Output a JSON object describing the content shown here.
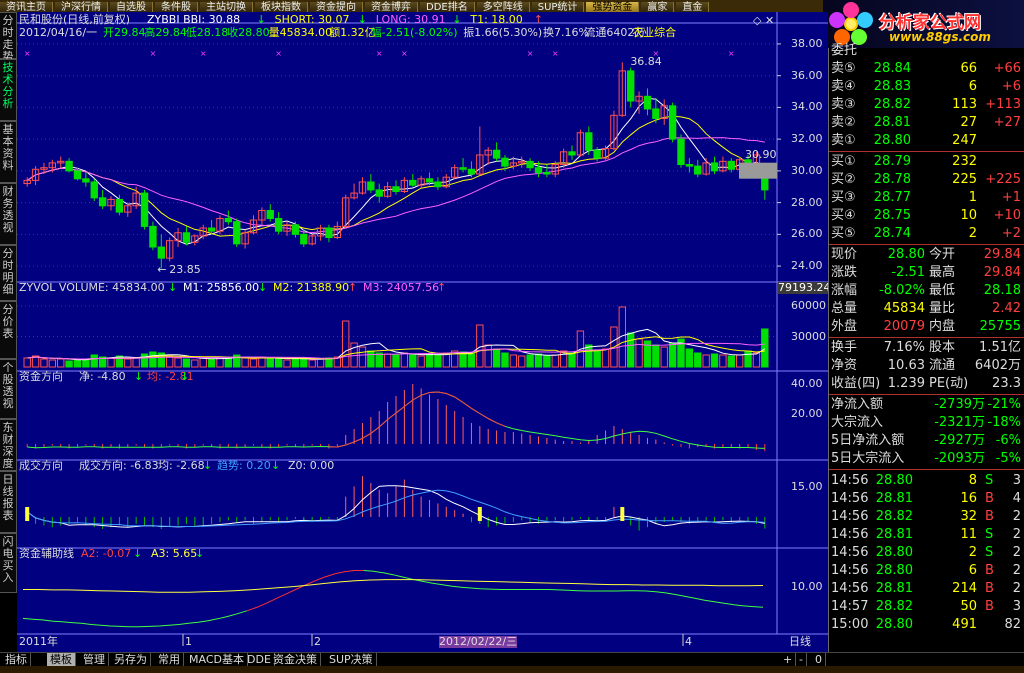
{
  "top_menu": [
    "资讯主页",
    "沪深行情",
    "自选股",
    "条件股",
    "主站切换",
    "板块指数",
    "资金提向",
    "资金博弈",
    "DDE排名",
    "多空阵线",
    "SUP统计",
    "强势资金",
    "赢家",
    "直金"
  ],
  "top_menu_active": 11,
  "logo": {
    "name": "分析家公式网",
    "url": "www.88gs.com"
  },
  "left_tabs": [
    {
      "label": "分时走势",
      "active": false
    },
    {
      "label": "技术分析",
      "active": true
    },
    {
      "label": "基本资料",
      "active": false
    },
    {
      "label": "财务透视",
      "active": false
    },
    {
      "label": "分时明细",
      "active": false
    },
    {
      "label": "分价表",
      "active": false
    },
    {
      "label": "个股透视",
      "active": false
    },
    {
      "label": "东财深度",
      "active": false
    },
    {
      "label": "日线报表",
      "active": false
    },
    {
      "label": "闪电买入",
      "active": false
    }
  ],
  "chart_data": {
    "type": "candlestick",
    "colors": {
      "up": "#ff5050",
      "down": "#00e000",
      "bg": "#000080",
      "grid": "#3030c0",
      "text": "#dddddd"
    },
    "main": {
      "title": "民和股份(日线,前复权)",
      "indicators": [
        {
          "label": "ZYBBI BBI: 30.88",
          "color": "#ffffff",
          "arrow": "down"
        },
        {
          "label": "SHORT: 30.07",
          "color": "#ffff00",
          "arrow": "down"
        },
        {
          "label": "LONG: 30.91",
          "color": "#ff60ff",
          "arrow": "down"
        },
        {
          "label": "T1: 18.00",
          "color": "#ffff00",
          "arrow": "up"
        }
      ],
      "info_date": "2012/04/16/一",
      "info": [
        {
          "t": "开29.84",
          "c": "#00ff00"
        },
        {
          "t": "高29.84",
          "c": "#00ff00"
        },
        {
          "t": "低28.18",
          "c": "#00ff00"
        },
        {
          "t": "收28.80",
          "c": "#00ff00"
        },
        {
          "t": "量45834.00",
          "c": "#ffff00"
        },
        {
          "t": "额1.32亿",
          "c": "#ffff00"
        },
        {
          "t": "幅-2.51(-8.02%)",
          "c": "#00ff00"
        },
        {
          "t": "振1.66(5.30%)",
          "c": "#dddddd"
        },
        {
          "t": "换7.16%",
          "c": "#dddddd"
        },
        {
          "t": "流通6402万",
          "c": "#dddddd"
        },
        {
          "t": "农业综合",
          "c": "#ffff00"
        }
      ],
      "y_ticks": [
        "38.00",
        "36.00",
        "34.00",
        "32.00",
        "30.00",
        "28.00",
        "26.00",
        "24.00"
      ],
      "ylim": [
        23.5,
        38.5
      ],
      "annotations": {
        "high": "36.84",
        "low": "23.85",
        "price_tag": "30.90"
      }
    },
    "volume": {
      "label": "ZYVOL VOLUME: 45834.00",
      "m1": "M1: 25856.00",
      "m2": "M2: 21388.90",
      "m3": "M3: 24057.56",
      "ticks": [
        "60000",
        "30000"
      ],
      "side_value": "79193.24"
    },
    "fund_direction": {
      "label": "资金方向",
      "value": "净: -4.80",
      "avg": "均: -2.81",
      "ticks": [
        "40.00",
        "20.00"
      ]
    },
    "trade_direction": {
      "label": "成交方向",
      "value": "成交方向: -6.83",
      "avg": "均: -2.68",
      "trend": "趋势: 0.20",
      "z0": "Z0: 0.00",
      "tick": "15.00"
    },
    "fund_aux": {
      "label": "资金辅助线",
      "a2": "A2: -0.07",
      "a3": "A3: 5.65",
      "tick": "10.00"
    },
    "x_axis": {
      "labels": [
        "2011年",
        "1",
        "2",
        "4"
      ],
      "cursor": "2012/02/22/三",
      "period": "日线"
    },
    "candles": [
      [
        29.2,
        29.6,
        29.0,
        29.4
      ],
      [
        29.4,
        30.3,
        29.1,
        30.1
      ],
      [
        30.1,
        30.5,
        29.8,
        30.2
      ],
      [
        30.2,
        30.7,
        29.9,
        30.5
      ],
      [
        30.5,
        30.9,
        30.2,
        30.6
      ],
      [
        30.6,
        30.8,
        29.9,
        30.0
      ],
      [
        30.0,
        30.2,
        29.4,
        29.5
      ],
      [
        29.5,
        29.9,
        29.0,
        29.3
      ],
      [
        29.3,
        29.5,
        28.1,
        28.3
      ],
      [
        28.3,
        28.8,
        27.6,
        27.8
      ],
      [
        27.8,
        28.4,
        27.5,
        28.2
      ],
      [
        28.2,
        28.5,
        27.2,
        27.4
      ],
      [
        27.4,
        28.0,
        27.1,
        27.8
      ],
      [
        27.8,
        29.0,
        27.6,
        28.6
      ],
      [
        28.6,
        28.8,
        26.3,
        26.5
      ],
      [
        26.5,
        26.8,
        25.0,
        25.2
      ],
      [
        25.2,
        26.0,
        23.85,
        24.5
      ],
      [
        24.5,
        25.8,
        24.3,
        25.6
      ],
      [
        25.6,
        26.4,
        25.2,
        26.1
      ],
      [
        26.1,
        26.5,
        25.3,
        25.5
      ],
      [
        25.5,
        26.0,
        25.3,
        25.9
      ],
      [
        25.9,
        26.6,
        25.7,
        26.4
      ],
      [
        26.4,
        26.9,
        26.0,
        26.2
      ],
      [
        26.2,
        27.2,
        26.0,
        27.0
      ],
      [
        27.0,
        27.5,
        26.6,
        26.8
      ],
      [
        26.8,
        27.0,
        25.2,
        25.4
      ],
      [
        25.4,
        26.3,
        25.1,
        26.1
      ],
      [
        26.1,
        27.2,
        26.0,
        26.9
      ],
      [
        26.9,
        27.7,
        26.6,
        27.5
      ],
      [
        27.5,
        27.9,
        26.8,
        27.0
      ],
      [
        27.0,
        27.4,
        26.0,
        26.2
      ],
      [
        26.2,
        26.8,
        25.9,
        26.6
      ],
      [
        26.6,
        26.8,
        25.8,
        26.0
      ],
      [
        26.0,
        26.3,
        25.2,
        25.4
      ],
      [
        25.4,
        26.0,
        25.3,
        25.9
      ],
      [
        25.9,
        26.6,
        25.6,
        26.4
      ],
      [
        26.4,
        26.6,
        25.5,
        25.8
      ],
      [
        25.8,
        26.8,
        25.7,
        26.5
      ],
      [
        26.5,
        28.5,
        26.4,
        28.3
      ],
      [
        28.3,
        29.2,
        28.2,
        28.6
      ],
      [
        28.6,
        29.6,
        28.5,
        29.3
      ],
      [
        29.3,
        29.8,
        28.6,
        28.8
      ],
      [
        28.8,
        29.2,
        28.0,
        28.4
      ],
      [
        28.4,
        29.3,
        28.3,
        29.0
      ],
      [
        29.0,
        29.4,
        28.5,
        28.7
      ],
      [
        28.7,
        29.6,
        28.6,
        29.4
      ],
      [
        29.4,
        29.8,
        29.0,
        29.1
      ],
      [
        29.1,
        29.7,
        28.9,
        29.5
      ],
      [
        29.5,
        29.9,
        29.1,
        29.3
      ],
      [
        29.3,
        29.6,
        28.8,
        29.0
      ],
      [
        29.0,
        29.8,
        28.9,
        29.6
      ],
      [
        29.6,
        30.4,
        29.5,
        30.2
      ],
      [
        30.2,
        30.8,
        29.9,
        30.1
      ],
      [
        30.1,
        30.6,
        29.6,
        29.8
      ],
      [
        29.8,
        32.8,
        29.7,
        31.0
      ],
      [
        31.0,
        31.5,
        30.4,
        31.3
      ],
      [
        31.3,
        31.8,
        30.6,
        30.8
      ],
      [
        30.8,
        31.0,
        30.0,
        30.3
      ],
      [
        30.3,
        30.9,
        30.1,
        30.5
      ],
      [
        30.5,
        30.9,
        30.2,
        30.6
      ],
      [
        30.6,
        30.8,
        30.0,
        30.2
      ],
      [
        30.2,
        30.6,
        29.6,
        29.9
      ],
      [
        29.9,
        30.4,
        29.6,
        29.8
      ],
      [
        29.8,
        30.6,
        29.6,
        30.4
      ],
      [
        30.4,
        31.4,
        30.2,
        31.2
      ],
      [
        31.2,
        31.6,
        30.7,
        31.0
      ],
      [
        31.0,
        32.6,
        30.9,
        32.4
      ],
      [
        32.4,
        32.8,
        31.0,
        31.3
      ],
      [
        31.3,
        31.5,
        30.6,
        30.8
      ],
      [
        30.8,
        31.6,
        30.7,
        31.4
      ],
      [
        31.4,
        33.8,
        31.3,
        33.5
      ],
      [
        33.5,
        36.84,
        33.4,
        36.3
      ],
      [
        36.3,
        36.5,
        34.0,
        34.4
      ],
      [
        34.4,
        35.0,
        33.6,
        34.7
      ],
      [
        34.7,
        35.2,
        33.5,
        33.9
      ],
      [
        33.9,
        34.6,
        33.0,
        33.3
      ],
      [
        33.3,
        34.5,
        32.9,
        34.1
      ],
      [
        34.1,
        34.3,
        31.8,
        32.0
      ],
      [
        32.0,
        32.3,
        30.2,
        30.4
      ],
      [
        30.4,
        30.8,
        29.9,
        30.3
      ],
      [
        30.3,
        30.7,
        29.6,
        29.8
      ],
      [
        29.8,
        30.8,
        29.7,
        30.5
      ],
      [
        30.5,
        30.9,
        29.8,
        30.0
      ],
      [
        30.0,
        30.9,
        29.9,
        30.6
      ],
      [
        30.6,
        30.8,
        29.9,
        30.1
      ],
      [
        30.1,
        30.9,
        30.0,
        30.7
      ],
      [
        30.7,
        31.0,
        30.2,
        30.4
      ],
      [
        30.4,
        31.2,
        30.1,
        31.0
      ],
      [
        29.84,
        29.84,
        28.18,
        28.8
      ]
    ],
    "volumes": [
      9,
      11,
      8,
      7,
      8,
      6,
      7,
      8,
      12,
      10,
      9,
      11,
      8,
      9,
      13,
      15,
      14,
      10,
      9,
      8,
      7,
      9,
      8,
      10,
      9,
      12,
      9,
      8,
      10,
      8,
      9,
      7,
      8,
      9,
      7,
      8,
      9,
      10,
      46,
      24,
      20,
      16,
      14,
      13,
      12,
      14,
      12,
      11,
      13,
      12,
      14,
      16,
      15,
      13,
      42,
      22,
      18,
      14,
      12,
      11,
      12,
      13,
      11,
      12,
      16,
      14,
      36,
      22,
      16,
      18,
      40,
      60,
      34,
      28,
      26,
      22,
      20,
      24,
      28,
      18,
      14,
      12,
      13,
      12,
      11,
      12,
      16,
      14,
      38
    ],
    "fund_bars": [
      -2,
      -3,
      -2,
      -1,
      -2,
      -3,
      -2,
      -1,
      -2,
      -3,
      -2,
      -3,
      -2,
      -1,
      -2,
      -3,
      -2,
      -1,
      -2,
      -3,
      -2,
      -1,
      -2,
      -3,
      -2,
      -3,
      -2,
      -1,
      -2,
      -3,
      -2,
      -1,
      -2,
      -2,
      -1,
      -2,
      -3,
      -2,
      6,
      10,
      14,
      18,
      22,
      28,
      32,
      36,
      40,
      37,
      33,
      30,
      26,
      22,
      18,
      14,
      12,
      10,
      9,
      8,
      8,
      7,
      6,
      5,
      4,
      3,
      2,
      2,
      1,
      2,
      6,
      9,
      12,
      10,
      8,
      6,
      4,
      3,
      1,
      -1,
      -2,
      -3,
      -2,
      -2,
      -3,
      -2,
      -2,
      -3,
      -2,
      -4,
      -4.8
    ],
    "trade_bars": [
      3,
      -4,
      -5,
      -6,
      -5,
      -4,
      -3,
      -5,
      -6,
      -7,
      -6,
      -5,
      -6,
      -4,
      -5,
      -6,
      -7,
      -6,
      -5,
      -4,
      -6,
      -5,
      -4,
      -3,
      -2,
      -3,
      -2,
      -4,
      -3,
      -2,
      -3,
      -2,
      -1,
      -2,
      -3,
      -2,
      -1,
      -2,
      12,
      18,
      24,
      20,
      16,
      14,
      18,
      22,
      16,
      12,
      10,
      8,
      6,
      4,
      2,
      -3,
      -4,
      -6,
      -5,
      -4,
      -3,
      -2,
      -3,
      -4,
      -3,
      -2,
      -3,
      -2,
      -1,
      -2,
      -3,
      -2,
      6,
      4,
      -5,
      -8,
      -6,
      -4,
      -3,
      -2,
      -3,
      -4,
      -3,
      -2,
      -3,
      -2,
      -3,
      -2,
      -3,
      -4,
      -6.8
    ],
    "fund_aux_a2": [
      -3.0,
      -3.2,
      -3.4,
      -3.7,
      -3.9,
      -4.1,
      -4.3,
      -4.6,
      -4.8,
      -5.0,
      -5.1,
      -5.2,
      -5.2,
      -5.1,
      -5.0,
      -4.8,
      -4.6,
      -4.3,
      -4.0,
      -3.6,
      -3.1,
      -2.5,
      -1.8,
      -1.0,
      -0.1,
      1.0,
      2.2,
      3.4,
      4.6,
      5.8,
      6.9,
      7.9,
      8.7,
      9.3,
      9.6,
      9.6,
      9.4,
      9.0,
      8.5,
      7.9,
      7.3,
      6.8,
      6.3,
      5.9,
      5.5,
      5.2,
      5.0,
      4.8,
      4.7,
      4.6,
      4.6,
      4.6,
      4.6,
      4.6,
      4.6,
      4.5,
      4.4,
      4.3,
      4.2,
      4.2,
      4.2,
      4.2,
      4.3,
      4.3,
      4.2,
      4.0,
      3.7,
      3.3,
      2.8,
      2.3,
      1.8,
      1.4,
      1.0,
      0.6,
      0.3,
      0.1,
      -0.07
    ],
    "fund_aux_a3": [
      4.6,
      4.6,
      4.5,
      4.5,
      4.4,
      4.3,
      4.2,
      4.1,
      4.0,
      3.9,
      3.9,
      3.9,
      4.0,
      4.1,
      4.3,
      4.5,
      4.8,
      5.1,
      5.4,
      5.8,
      6.2,
      6.6,
      6.9,
      7.1,
      7.2,
      7.2,
      7.2,
      7.1,
      7.0,
      6.9,
      6.8,
      6.7,
      6.6,
      6.5,
      6.4,
      6.3,
      6.2,
      6.1,
      6.0,
      5.9,
      5.9,
      5.8,
      5.8,
      5.7,
      5.7,
      5.7,
      5.6,
      5.6,
      5.6,
      5.65
    ]
  },
  "quote": {
    "sells": [
      {
        "label": "卖⑤",
        "price": "28.84",
        "vol": "66",
        "chg": "+66"
      },
      {
        "label": "卖④",
        "price": "28.83",
        "vol": "6",
        "chg": "+6"
      },
      {
        "label": "卖③",
        "price": "28.82",
        "vol": "113",
        "chg": "+113"
      },
      {
        "label": "卖②",
        "price": "28.81",
        "vol": "27",
        "chg": "+27"
      },
      {
        "label": "卖①",
        "price": "28.80",
        "vol": "247",
        "chg": ""
      }
    ],
    "buys": [
      {
        "label": "买①",
        "price": "28.79",
        "vol": "232",
        "chg": ""
      },
      {
        "label": "买②",
        "price": "28.78",
        "vol": "225",
        "chg": "+225"
      },
      {
        "label": "买③",
        "price": "28.77",
        "vol": "1",
        "chg": "+1"
      },
      {
        "label": "买④",
        "price": "28.75",
        "vol": "10",
        "chg": "+10"
      },
      {
        "label": "买⑤",
        "price": "28.74",
        "vol": "2",
        "chg": "+2"
      }
    ],
    "stats": [
      [
        "现价",
        "28.80",
        "今开",
        "29.84"
      ],
      [
        "涨跌",
        "-2.51",
        "最高",
        "29.84"
      ],
      [
        "涨幅",
        "-8.02%",
        "最低",
        "28.18"
      ],
      [
        "总量",
        "45834",
        "量比",
        "2.42"
      ],
      [
        "外盘",
        "20079",
        "内盘",
        "25755"
      ]
    ],
    "stats2": [
      [
        "换手",
        "7.16%",
        "股本",
        "1.51亿"
      ],
      [
        "净资",
        "10.63",
        "流通",
        "6402万"
      ],
      [
        "收益(四)",
        "1.239",
        "PE(动)",
        "23.3"
      ]
    ],
    "flows": [
      [
        "净流入额",
        "-2739万",
        "-21%"
      ],
      [
        "大宗流入",
        "-2321万",
        "-18%"
      ],
      [
        "5日净流入额",
        "-2927万",
        "-6%"
      ],
      [
        "5日大宗流入",
        "-2093万",
        "-5%"
      ]
    ],
    "ticks": [
      [
        "14:56",
        "28.80",
        "8",
        "S",
        "3"
      ],
      [
        "14:56",
        "28.81",
        "16",
        "B",
        "4"
      ],
      [
        "14:56",
        "28.82",
        "32",
        "B",
        "2"
      ],
      [
        "14:56",
        "28.81",
        "11",
        "S",
        "2"
      ],
      [
        "14:56",
        "28.80",
        "2",
        "S",
        "2"
      ],
      [
        "14:56",
        "28.80",
        "6",
        "B",
        "2"
      ],
      [
        "14:56",
        "28.81",
        "214",
        "B",
        "2"
      ],
      [
        "14:57",
        "28.82",
        "50",
        "B",
        "3"
      ],
      [
        "15:00",
        "28.80",
        "491",
        "",
        "82"
      ]
    ]
  },
  "bottom_tabs": [
    {
      "label": "指标",
      "active": false
    },
    {
      "label": "模板",
      "active": true
    },
    {
      "label": "管理",
      "active": false
    },
    {
      "label": "另存为",
      "active": false
    },
    {
      "label": "常用",
      "active": false
    },
    {
      "label": "MACD基本",
      "active": false
    },
    {
      "label": "DDE",
      "active": false
    },
    {
      "label": "资金决策",
      "active": false
    },
    {
      "label": "SUP决策",
      "active": false
    }
  ],
  "zoom_controls": [
    "+",
    "-",
    "0"
  ]
}
